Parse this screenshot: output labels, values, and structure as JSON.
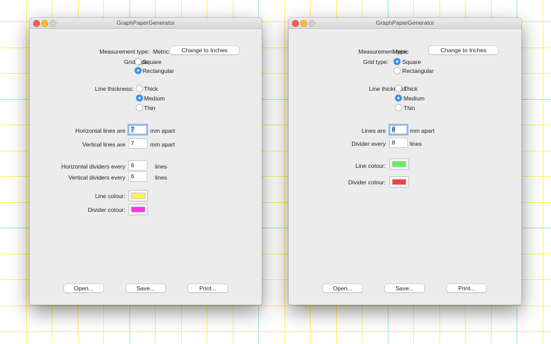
{
  "background": {
    "line_color": "#fff15a",
    "divider_color": "#9ee8c4",
    "divider_every": 5
  },
  "windows": [
    {
      "title": "GraphPaperGenerator",
      "measurement_label": "Measurement type:",
      "measurement_value": "Metric",
      "change_units_button": "Change to Inches",
      "grid_type_label": "Grid type:",
      "grid_type_options": [
        {
          "label": "Square",
          "selected": false
        },
        {
          "label": "Rectangular",
          "selected": true
        }
      ],
      "thickness_label": "Line thickness:",
      "thickness_options": [
        {
          "label": "Thick",
          "selected": false
        },
        {
          "label": "Medium",
          "selected": true
        },
        {
          "label": "Thin",
          "selected": false
        }
      ],
      "spacing_rows": [
        {
          "label": "Horizontal lines are",
          "value": "7",
          "unit": "mm apart",
          "focused": true
        },
        {
          "label": "Vertical lines are",
          "value": "7",
          "unit": "mm apart",
          "focused": false
        }
      ],
      "divider_rows": [
        {
          "label": "Horizontal dividers every",
          "value": "6",
          "unit": "lines"
        },
        {
          "label": "Vertical dividers every",
          "value": "6",
          "unit": "lines"
        }
      ],
      "line_colour_label": "Line colour:",
      "line_colour": "#fff15a",
      "divider_colour_label": "Divider colour:",
      "divider_colour": "#f535e0",
      "buttons": {
        "open": "Open...",
        "save": "Save...",
        "print": "Print..."
      }
    },
    {
      "title": "GraphPaperGenerator",
      "measurement_label": "Measurement type:",
      "measurement_value": "Metric",
      "change_units_button": "Change to Inches",
      "grid_type_label": "Grid type:",
      "grid_type_options": [
        {
          "label": "Square",
          "selected": true
        },
        {
          "label": "Rectangular",
          "selected": false
        }
      ],
      "thickness_label": "Line thickness:",
      "thickness_options": [
        {
          "label": "Thick",
          "selected": false
        },
        {
          "label": "Medium",
          "selected": true
        },
        {
          "label": "Thin",
          "selected": false
        }
      ],
      "spacing_rows": [
        {
          "label": "Lines are",
          "value": "8",
          "unit": "mm apart",
          "focused": true
        },
        {
          "label": "Divider every",
          "value": "8",
          "unit": "lines",
          "focused": false
        }
      ],
      "line_colour_label": "Line colour:",
      "line_colour": "#62f05c",
      "divider_colour_label": "Divider colour:",
      "divider_colour": "#ee4236",
      "buttons": {
        "open": "Open...",
        "save": "Save...",
        "print": "Print..."
      }
    }
  ]
}
